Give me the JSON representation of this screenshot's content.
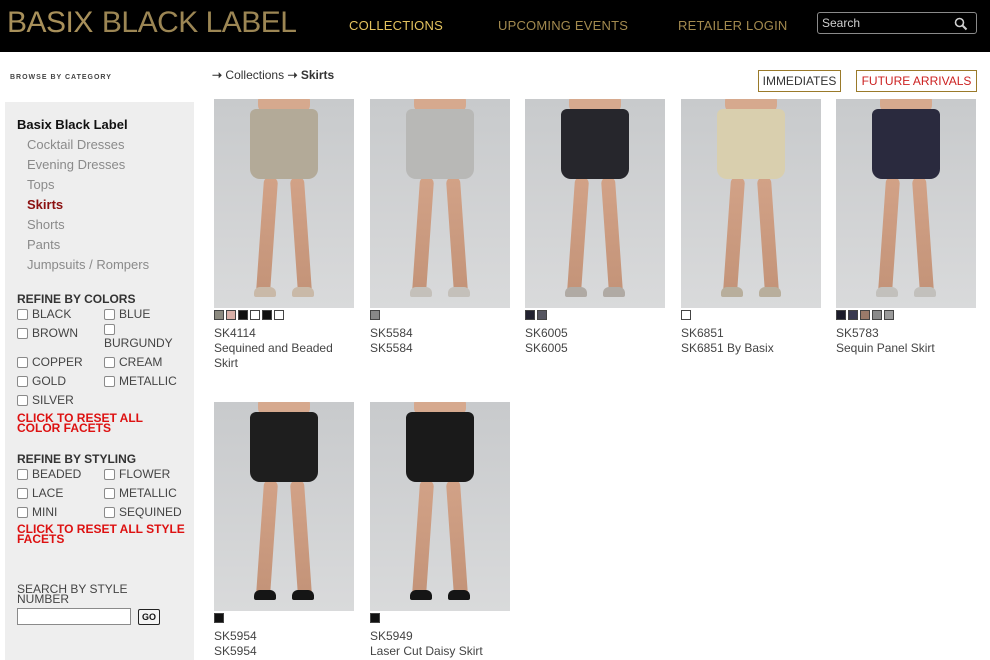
{
  "header": {
    "logo_part1": "BASIX",
    "logo_part2": "BLACK LABEL",
    "nav": [
      "COLLECTIONS",
      "UPCOMING EVENTS",
      "RETAILER LOGIN"
    ],
    "search_placeholder": "Search",
    "accent": "#e4c35f",
    "logo_color": "#a8905a"
  },
  "sidebar": {
    "browse_label": "BROWSE BY CATEGORY",
    "title": "Basix Black Label",
    "categories": [
      "Cocktail Dresses",
      "Evening Dresses",
      "Tops",
      "Skirts",
      "Shorts",
      "Pants",
      "Jumpsuits / Rompers"
    ],
    "active_category": "Skirts",
    "refine_colors_heading": "REFINE BY COLORS",
    "colors": [
      "BLACK",
      "BLUE",
      "BROWN",
      "BURGUNDY",
      "COPPER",
      "CREAM",
      "GOLD",
      "METALLIC",
      "SILVER"
    ],
    "reset_colors": "CLICK TO RESET ALL COLOR FACETS",
    "refine_styling_heading": "REFINE BY STYLING",
    "styling": [
      "BEADED",
      "FLOWER",
      "LACE",
      "METALLIC",
      "MINI",
      "SEQUINED"
    ],
    "reset_styling": "CLICK TO RESET ALL STYLE FACETS",
    "style_search_label": "SEARCH BY STYLE NUMBER",
    "go_label": "GO"
  },
  "breadcrumb": {
    "parent": "Collections",
    "current": "Skirts"
  },
  "buttons": {
    "immediates": "IMMEDIATES",
    "future_arrivals": "FUTURE ARRIVALS"
  },
  "products": [
    {
      "sku": "SK4114",
      "name": "Sequined and Beaded Skirt",
      "skirt_color": "#b3aa98",
      "shoe_color": "#c9b9a8",
      "swatches": [
        "#8c8a80",
        "#d9b0a8",
        "#111111",
        "#ffffff",
        "#111111",
        "#ffffff"
      ]
    },
    {
      "sku": "SK5584",
      "name": "SK5584",
      "skirt_color": "#b8b8b6",
      "shoe_color": "#c4c0ba",
      "swatches": [
        "#888888"
      ]
    },
    {
      "sku": "SK6005",
      "name": "SK6005",
      "skirt_color": "#26262c",
      "shoe_color": "#b0aaa4",
      "swatches": [
        "#222230",
        "#555560"
      ]
    },
    {
      "sku": "SK6851",
      "name": "SK6851 By Basix",
      "skirt_color": "#d9cfae",
      "shoe_color": "#b8ae9c",
      "swatches": [
        "#ffffff"
      ]
    },
    {
      "sku": "SK5783",
      "name": "Sequin Panel Skirt",
      "skirt_color": "#2a2a3e",
      "shoe_color": "#c2c0bc",
      "swatches": [
        "#1c1c2a",
        "#3a3a50",
        "#9a7a6a",
        "#8a8a8a",
        "#9a9a9a"
      ]
    },
    {
      "sku": "SK5954",
      "name": "SK5954",
      "skirt_color": "#1e1e1e",
      "shoe_color": "#151515",
      "swatches": [
        "#111111"
      ]
    },
    {
      "sku": "SK5949",
      "name": "Laser Cut Daisy Skirt",
      "skirt_color": "#1a1a1a",
      "shoe_color": "#151515",
      "swatches": [
        "#111111"
      ]
    }
  ]
}
